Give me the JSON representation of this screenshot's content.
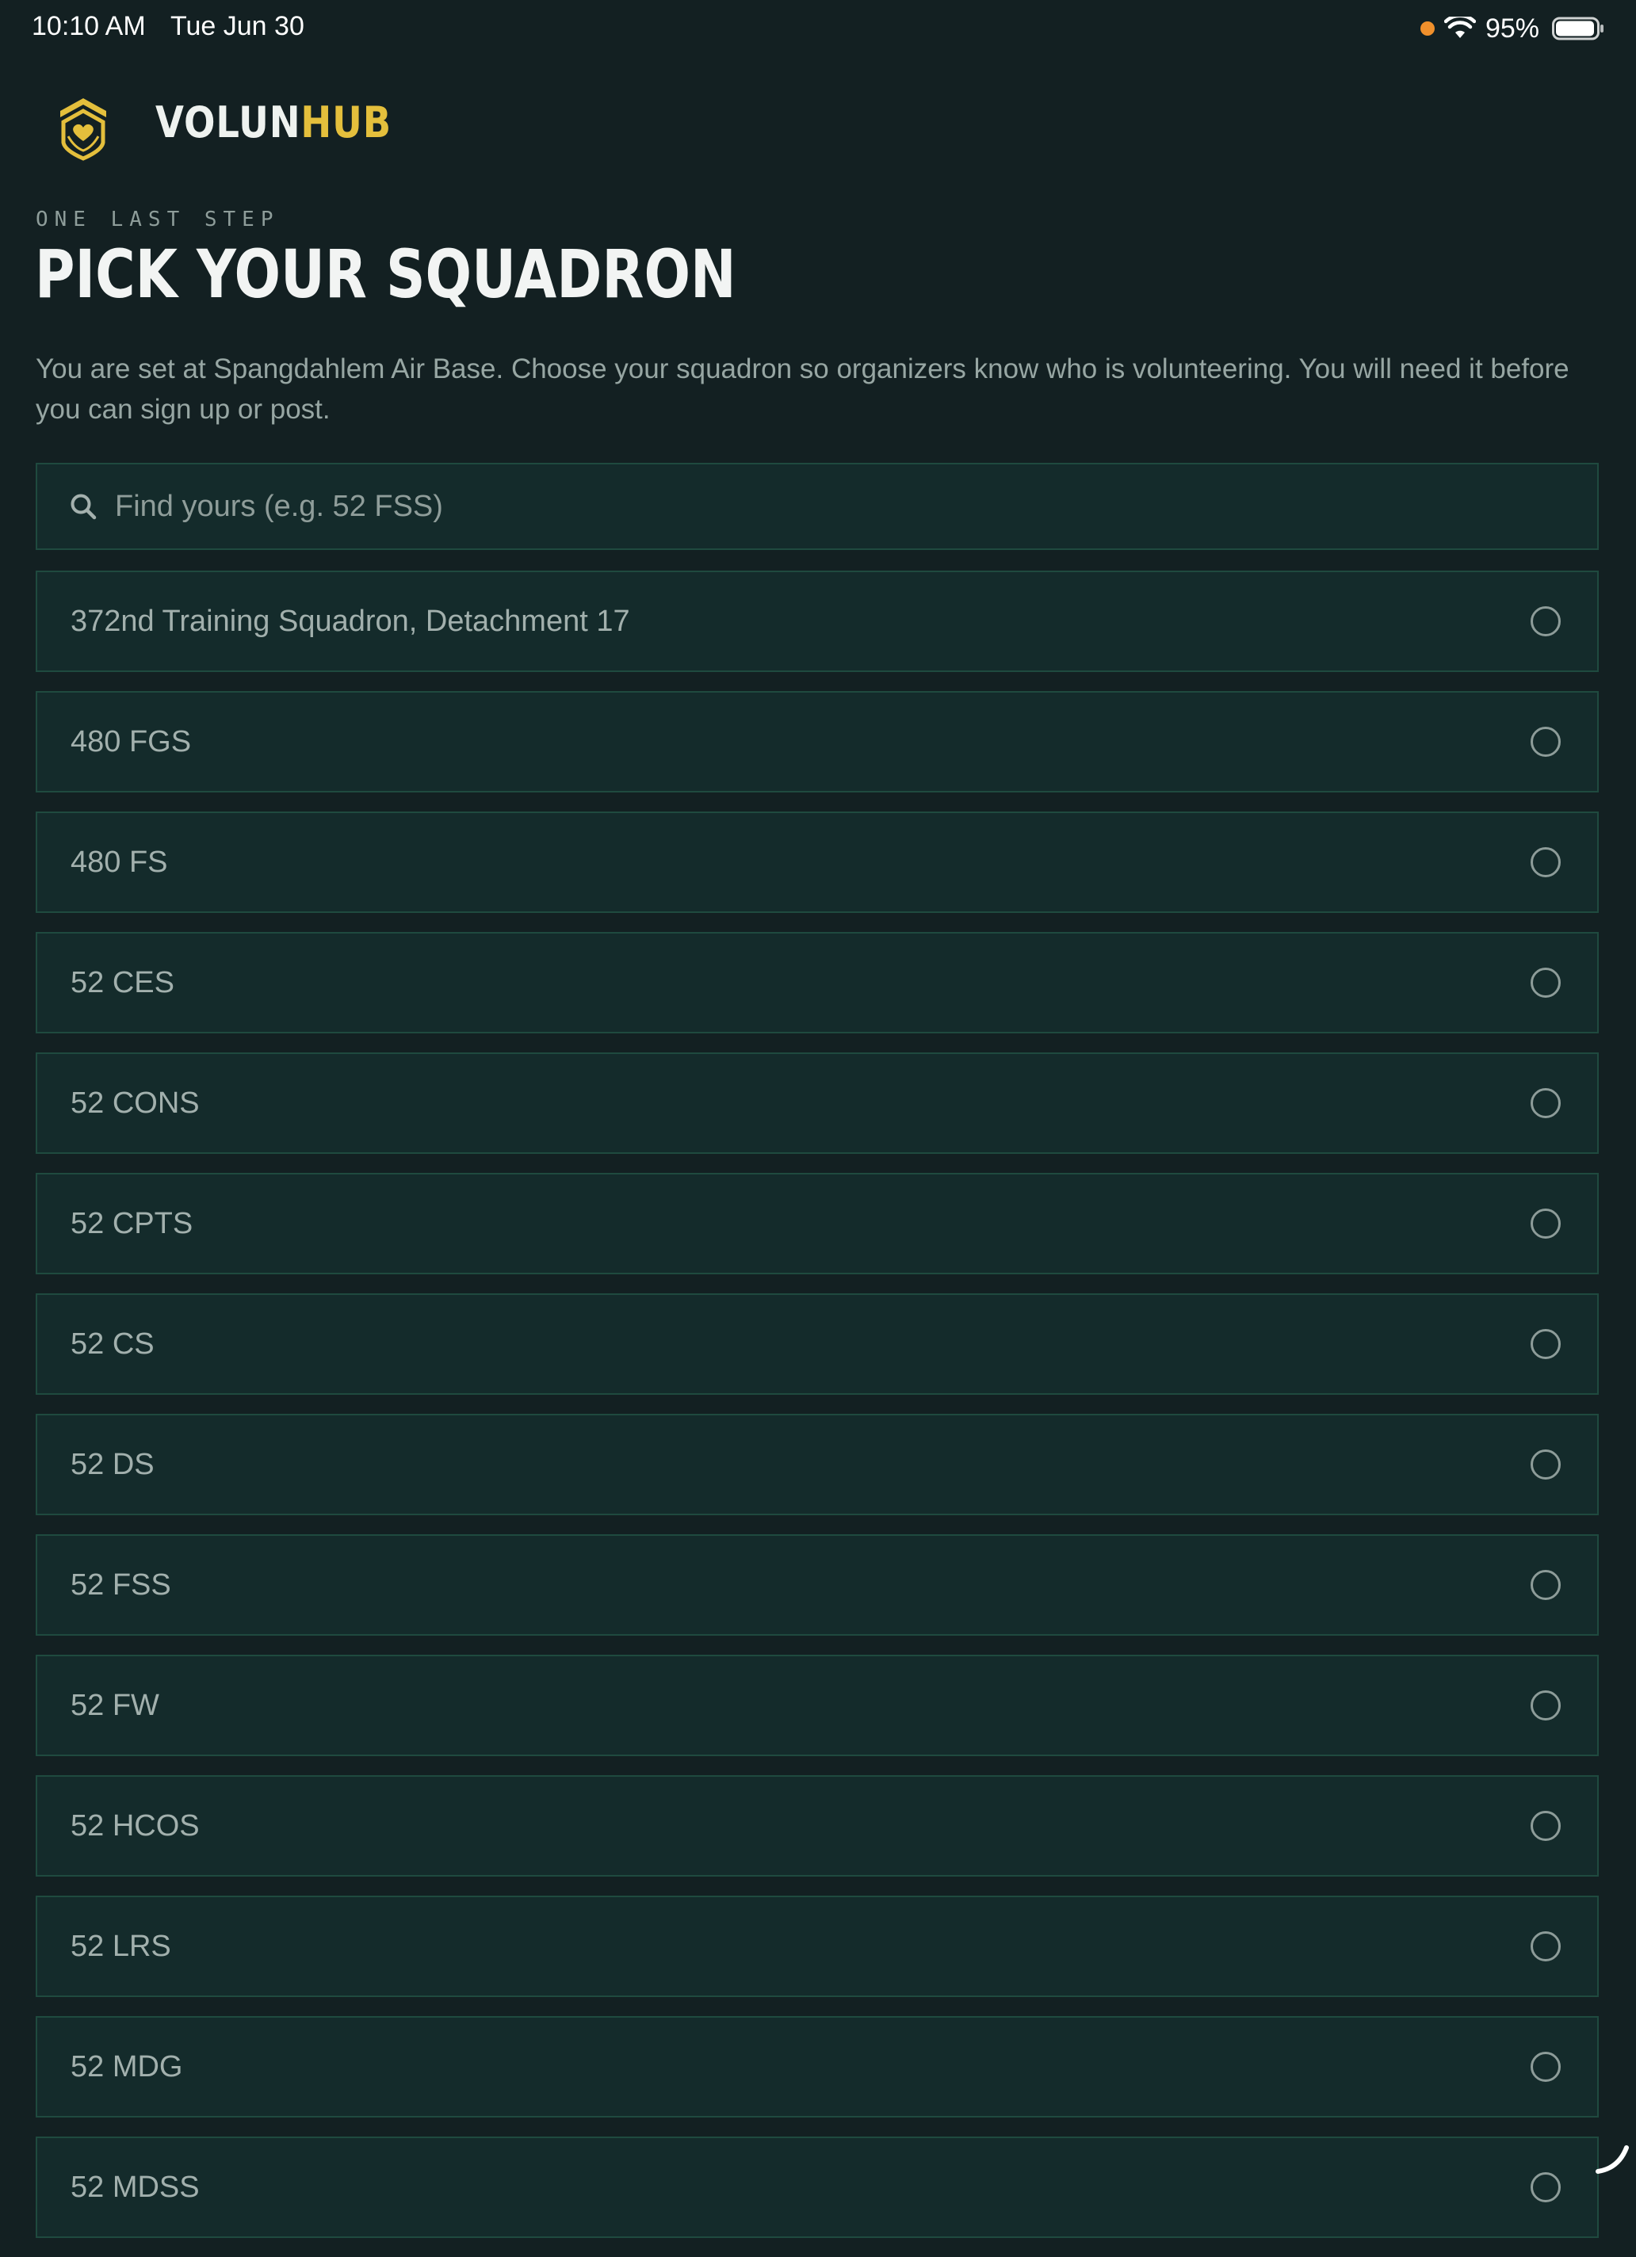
{
  "status_bar": {
    "time": "10:10 AM",
    "date": "Tue Jun 30",
    "battery": "95%",
    "icons": [
      "recording-dot-icon",
      "wifi-icon",
      "battery-icon"
    ]
  },
  "brand": {
    "part1": "VOLUN",
    "part2": "HUB",
    "logo_icon": "shield-heart-icon",
    "colors": {
      "primary": "#eef2ef",
      "accent": "#e4bf3c"
    }
  },
  "header": {
    "kicker": "ONE LAST STEP",
    "title": "PICK YOUR SQUADRON",
    "intro": "You are set at Spangdahlem Air Base. Choose your squadron so organizers know who is volunteering. You will need it before you can sign up or post."
  },
  "search": {
    "placeholder": "Find yours (e.g. 52 FSS)",
    "value": ""
  },
  "squadrons": [
    {
      "label": "372nd Training Squadron, Detachment 17",
      "selected": false
    },
    {
      "label": "480 FGS",
      "selected": false
    },
    {
      "label": "480 FS",
      "selected": false
    },
    {
      "label": "52 CES",
      "selected": false
    },
    {
      "label": "52 CONS",
      "selected": false
    },
    {
      "label": "52 CPTS",
      "selected": false
    },
    {
      "label": "52 CS",
      "selected": false
    },
    {
      "label": "52 DS",
      "selected": false
    },
    {
      "label": "52 FSS",
      "selected": false
    },
    {
      "label": "52 FW",
      "selected": false
    },
    {
      "label": "52 HCOS",
      "selected": false
    },
    {
      "label": "52 LRS",
      "selected": false
    },
    {
      "label": "52 MDG",
      "selected": false
    },
    {
      "label": "52 MDSS",
      "selected": false
    }
  ],
  "theme": {
    "background": "#132022",
    "card": "#142b2b",
    "card_border": "#1f4a3f"
  }
}
